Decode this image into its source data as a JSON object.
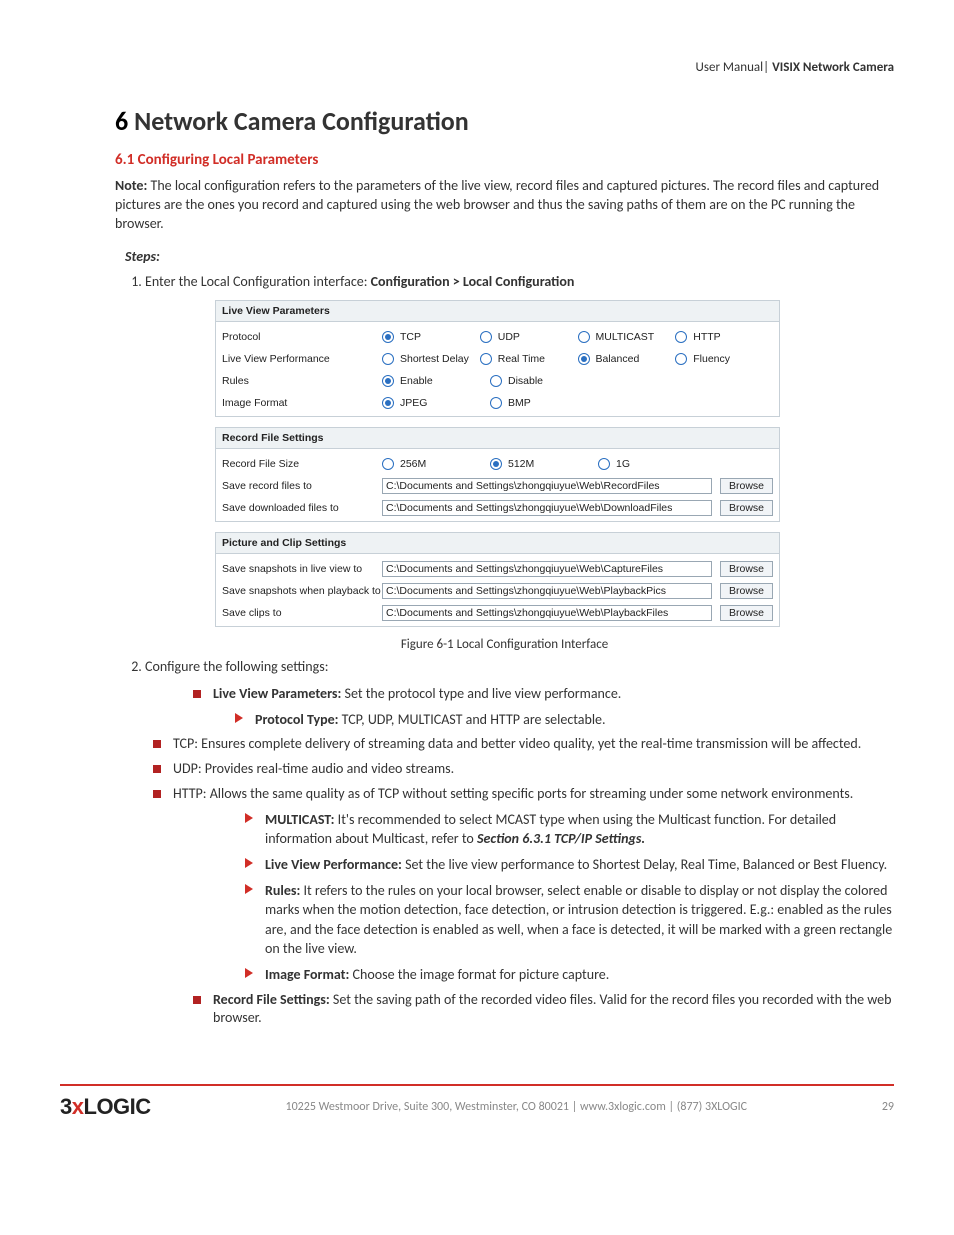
{
  "header": {
    "left": "User Manual|",
    "right": " VISIX Network Camera"
  },
  "chapter": {
    "num": "6",
    "title": "Network Camera Configuration"
  },
  "section": {
    "num": "6.1",
    "title": "Configuring Local Parameters"
  },
  "note_label": "Note:",
  "note_text": " The local configuration refers to the parameters of the live view, record files and captured pictures. The record files and captured pictures are the ones you record and captured using the web browser and thus the saving paths of them are on the PC running the browser.",
  "steps_label": "Steps:",
  "step1_prefix": "Enter the Local Configuration interface: ",
  "step1_path": "Configuration > Local Configuration",
  "step2": "Configure the following settings:",
  "panel": {
    "headers": [
      "Live View Parameters",
      "Record File Settings",
      "Picture and Clip Settings"
    ],
    "rows1": {
      "protocol_label": "Protocol",
      "protocol_opts": [
        "TCP",
        "UDP",
        "MULTICAST",
        "HTTP"
      ],
      "protocol_sel": 0,
      "lvp_label": "Live View Performance",
      "lvp_opts": [
        "Shortest Delay",
        "Real Time",
        "Balanced",
        "Fluency"
      ],
      "lvp_sel": 2,
      "rules_label": "Rules",
      "rules_opts": [
        "Enable",
        "Disable"
      ],
      "rules_sel": 0,
      "imgfmt_label": "Image Format",
      "imgfmt_opts": [
        "JPEG",
        "BMP"
      ],
      "imgfmt_sel": 0
    },
    "rows2": {
      "rfs_label": "Record File Size",
      "rfs_opts": [
        "256M",
        "512M",
        "1G"
      ],
      "rfs_sel": 1,
      "save_record_label": "Save record files to",
      "save_record_path": "C:\\Documents and Settings\\zhongqiuyue\\Web\\RecordFiles",
      "save_download_label": "Save downloaded files to",
      "save_download_path": "C:\\Documents and Settings\\zhongqiuyue\\Web\\DownloadFiles"
    },
    "rows3": {
      "snap_live_label": "Save snapshots in live view to",
      "snap_live_path": "C:\\Documents and Settings\\zhongqiuyue\\Web\\CaptureFiles",
      "snap_pb_label": "Save snapshots when playback to",
      "snap_pb_path": "C:\\Documents and Settings\\zhongqiuyue\\Web\\PlaybackPics",
      "clips_label": "Save clips to",
      "clips_path": "C:\\Documents and Settings\\zhongqiuyue\\Web\\PlaybackFiles"
    },
    "browse": "Browse"
  },
  "fig_caption": "Figure 6-1 Local Configuration Interface",
  "bullets": {
    "b1": {
      "label": "Live View Parameters:",
      "text": " Set the protocol type and live view performance."
    },
    "b1a": {
      "label": "Protocol Type:",
      "text": " TCP, UDP, MULTICAST and HTTP are selectable."
    },
    "tcp": "TCP: Ensures complete delivery of streaming data and better video quality, yet the real-time transmission will be affected.",
    "udp": "UDP: Provides real-time audio and video streams.",
    "http": "HTTP: Allows the same quality as of TCP without setting specific ports for streaming under some network environments.",
    "mcast": {
      "label": "MULTICAST:",
      "text": " It's recommended to select MCAST type when using the Multicast function. For detailed information about Multicast, refer to ",
      "ref": "Section 6.3.1 TCP/IP Settings."
    },
    "lvp": {
      "label": "Live View Performance:",
      "text": " Set the live view performance to Shortest Delay, Real Time, Balanced or Best Fluency."
    },
    "rules": {
      "label": "Rules:",
      "text": " It refers to the rules on your local browser, select enable or disable to display or not display the colored marks when the motion detection, face detection, or intrusion detection is triggered. E.g.: enabled as the rules are, and the face detection is enabled as well, when a face is detected, it will be marked with a green rectangle on the live view."
    },
    "imgfmt": {
      "label": "Image Format:",
      "text": " Choose the image format for picture capture."
    },
    "recfile": {
      "label": "Record File Settings:",
      "text": " Set the saving path of the recorded video files. Valid for the record files you recorded with the web browser."
    }
  },
  "footer": {
    "addr": "10225 Westmoor Drive, Suite 300, Westminster, CO 80021 | www.3xlogic.com | (877) 3XLOGIC",
    "page": "29"
  }
}
